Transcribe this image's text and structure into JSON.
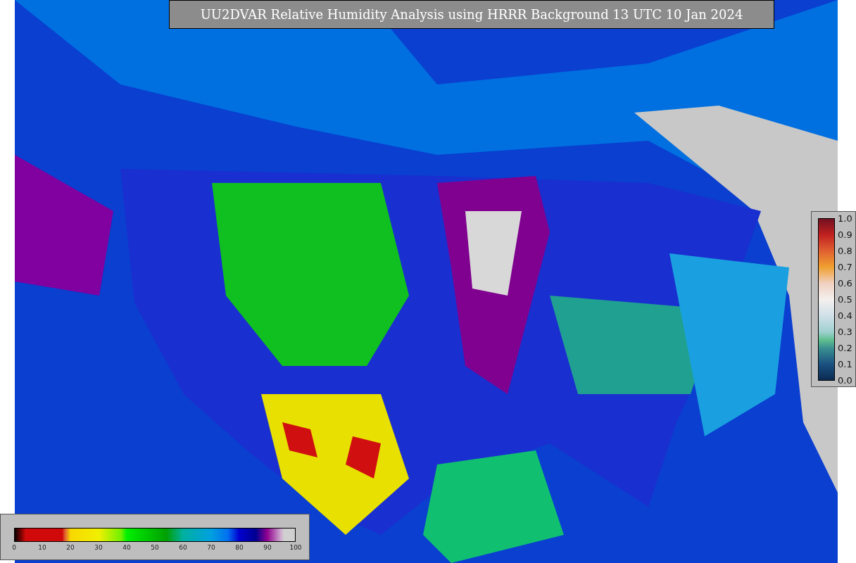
{
  "title": "UU2DVAR Relative Humidity Analysis using HRRR Background 13 UTC 10 Jan 2024",
  "humidity_colorbar": {
    "ticks": [
      "0",
      "10",
      "20",
      "30",
      "40",
      "50",
      "60",
      "70",
      "80",
      "90",
      "100"
    ]
  },
  "error_colorbar": {
    "ticks": [
      "1.0",
      "0.9",
      "0.8",
      "0.7",
      "0.6",
      "0.5",
      "0.4",
      "0.3",
      "0.2",
      "0.1",
      "0.0"
    ]
  }
}
